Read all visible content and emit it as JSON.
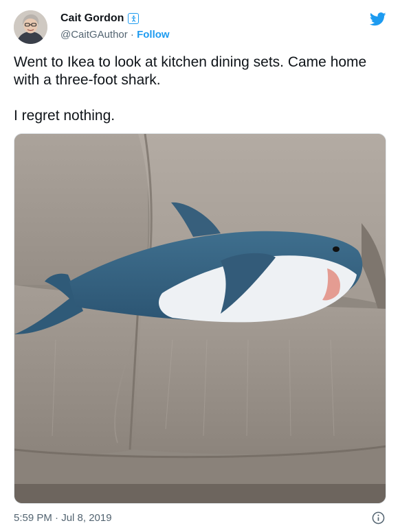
{
  "author": {
    "name": "Cait Gordon",
    "handle": "@CaitGAuthor",
    "separator": " · ",
    "follow_label": "Follow",
    "badge_icon": "accessibility-icon",
    "avatar_icon": "avatar"
  },
  "brand": {
    "icon": "twitter-bird-icon",
    "color": "#1d9bf0"
  },
  "tweet": {
    "text": "Went to Ikea to look at kitchen dining sets. Came home with a three-foot shark.\n\nI regret nothing."
  },
  "media": {
    "subject": "shark-plush-on-couch-photo"
  },
  "footer": {
    "timestamp": "5:59 PM · Jul 8, 2019",
    "info_icon": "info-icon"
  }
}
